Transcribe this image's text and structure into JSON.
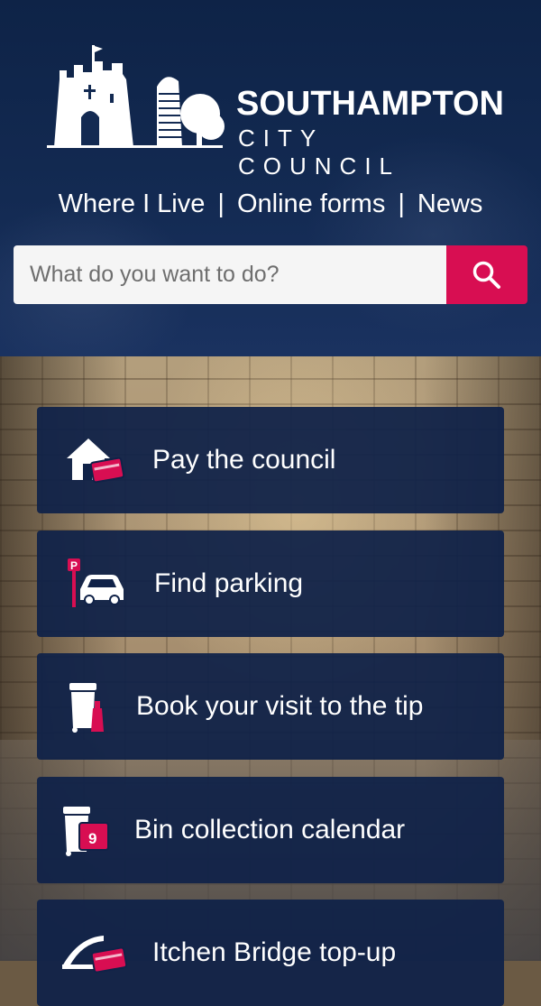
{
  "brand": {
    "name": "SOUTHAMPTON",
    "subtitle": "CITY COUNCIL"
  },
  "nav": {
    "items": [
      "Where I Live",
      "Online forms",
      "News"
    ],
    "separator": "|"
  },
  "search": {
    "placeholder": "What do you want to do?",
    "button_icon": "search-icon"
  },
  "services": [
    {
      "label": "Pay the council",
      "icon": "house-card-icon"
    },
    {
      "label": "Find parking",
      "icon": "parking-car-icon"
    },
    {
      "label": "Book your visit to the tip",
      "icon": "bin-bottle-icon"
    },
    {
      "label": "Bin collection calendar",
      "icon": "bin-calendar-icon"
    },
    {
      "label": "Itchen Bridge top-up",
      "icon": "bridge-card-icon"
    }
  ],
  "colors": {
    "header": "#132a52",
    "accent": "#d80e52",
    "card": "#102248",
    "text": "#ffffff"
  }
}
